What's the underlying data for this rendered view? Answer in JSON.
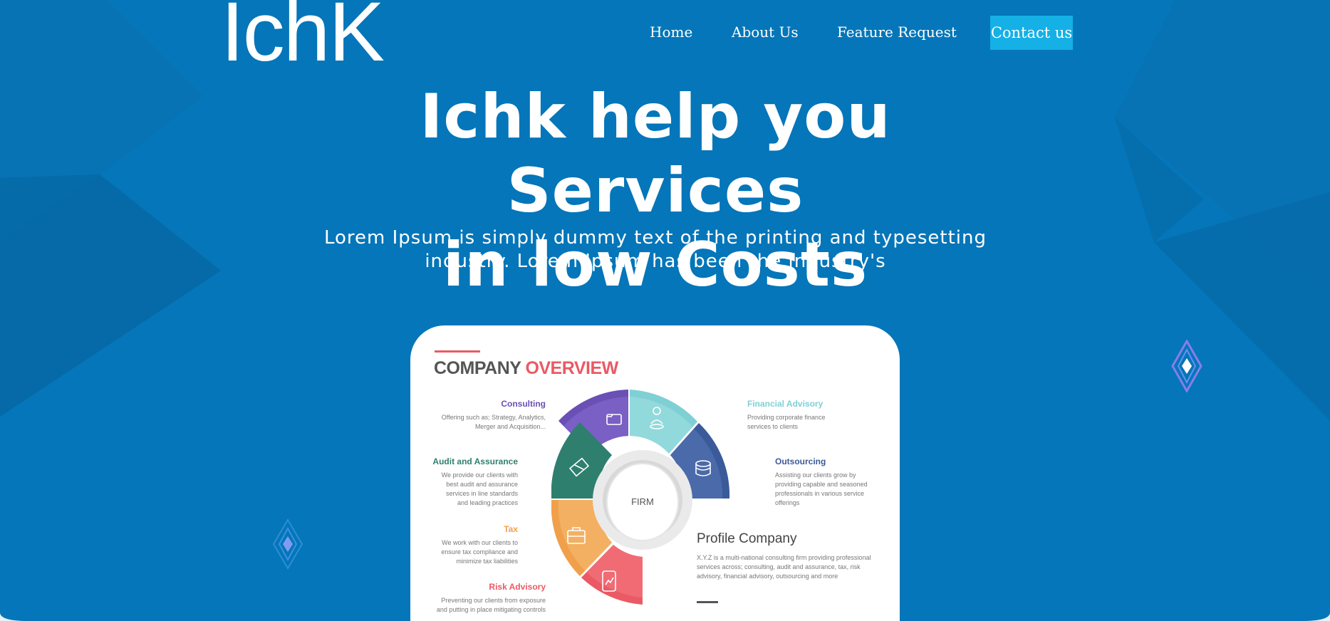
{
  "brand": {
    "logo": "IchK"
  },
  "nav": {
    "items": [
      "Home",
      "About Us",
      "Feature Request"
    ],
    "cta": "Contact us"
  },
  "hero": {
    "title_line1": "Ichk help you Services",
    "title_line2": "in low Costs",
    "subtitle_line1": "Lorem Ipsum is simply dummy text of the printing and typesetting",
    "subtitle_line2": "industry. Lorem Ipsum has been the industry's"
  },
  "overview": {
    "title_word1": "COMPANY",
    "title_word2": "OVERVIEW",
    "center_label": "FIRM",
    "services_left": [
      {
        "title": "Consulting",
        "desc": "Offering such as; Strategy, Analytics, Merger and Acquisition...",
        "color": "#6a4fb5"
      },
      {
        "title": "Audit and Assurance",
        "desc": "We provide our clients with best audit and assurance services in line standards and leading practices",
        "color": "#2f7f6f"
      },
      {
        "title": "Tax",
        "desc": "We work with our clients to ensure tax compliance and minimize tax liabilities",
        "color": "#f0a04b"
      },
      {
        "title": "Risk Advisory",
        "desc": "Preventing our clients from exposure and putting in place mitigating controls",
        "color": "#ea5a64"
      }
    ],
    "services_right": [
      {
        "title": "Financial Advisory",
        "desc": "Providing corporate finance services to clients",
        "color": "#7fd0d4"
      },
      {
        "title": "Outsourcing",
        "desc": "Assisting our clients grow by providing capable and seasoned professionals in various service offerings",
        "color": "#3a5a9a"
      }
    ],
    "profile": {
      "title": "Profile Company",
      "text": "X.Y.Z is a multi-national consulting firm providing professional services across;  consulting, audit and assurance, tax, risk advisory, financial advisory, outsourcing and more"
    }
  },
  "colors": {
    "background": "#0476b9",
    "cta": "#15b0e6",
    "accent": "#ea5a64"
  },
  "icons": [
    "folder-icon",
    "person-icon",
    "coins-icon",
    "handshake-icon",
    "briefcase-icon",
    "phone-chart-icon",
    "diamond-icon"
  ]
}
